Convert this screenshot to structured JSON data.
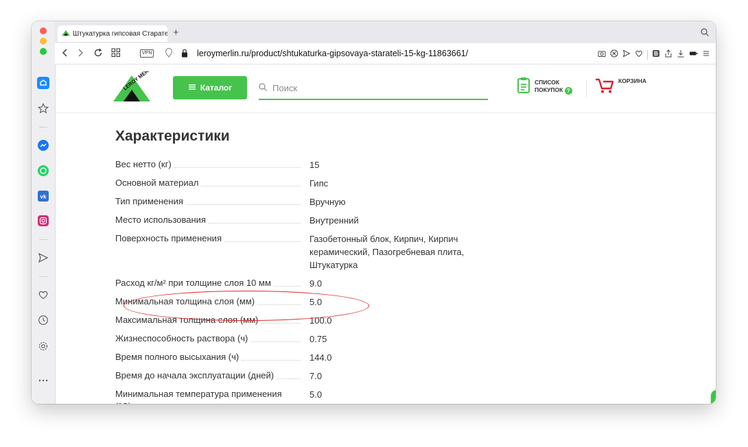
{
  "browser": {
    "tab_title": "Штукатурка гипсовая Старате",
    "new_tab": "+",
    "vpn_label": "VPN",
    "url": "leroymerlin.ru/product/shtukaturka-gipsovaya-starateli-15-kg-11863661/"
  },
  "header": {
    "logo_text": "LEROY MERLIN",
    "catalog_label": "Каталог",
    "search_placeholder": "Поиск",
    "list_line1": "СПИСОК",
    "list_line2": "ПОКУПОК",
    "list_badge": "?",
    "cart_label": "КОРЗИНА"
  },
  "specs": {
    "title": "Характеристики",
    "rows": [
      {
        "name": "Вес нетто (кг)",
        "value": "15"
      },
      {
        "name": "Основной материал",
        "value": "Гипс"
      },
      {
        "name": "Тип применения",
        "value": "Вручную"
      },
      {
        "name": "Место использования",
        "value": "Внутренний"
      },
      {
        "name": "Поверхность применения",
        "value": "Газобетонный блок, Кирпич, Кирпич керамический, Пазогребневая плита, Штукатурка"
      },
      {
        "name": "Расход кг/м² при толщине слоя 10 мм",
        "value": "9.0"
      },
      {
        "name": "Минимальная толщина слоя (мм)",
        "value": "5.0"
      },
      {
        "name": "Максимальная толщина слоя (мм)",
        "value": "100.0"
      },
      {
        "name": "Жизнеспособность раствора (ч)",
        "value": "0.75"
      },
      {
        "name": "Время полного высыхания (ч)",
        "value": "144.0"
      },
      {
        "name": "Время до начала эксплуатации (дней)",
        "value": "7.0"
      },
      {
        "name": "Минимальная температура применения (°C)",
        "value": "5.0"
      }
    ]
  },
  "colors": {
    "brand_green": "#46c34c",
    "highlight_red": "#e02a2a"
  }
}
